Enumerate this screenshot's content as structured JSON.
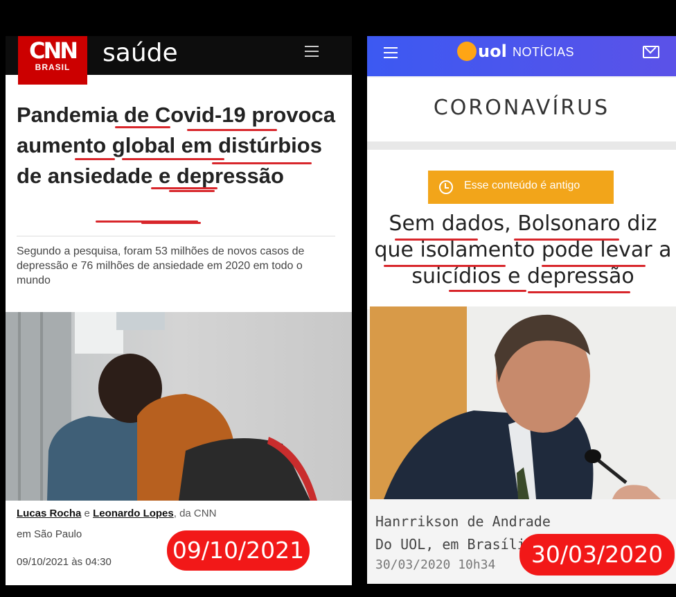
{
  "cnn": {
    "logo_main": "CNN",
    "logo_sub": "BRASIL",
    "section": "saúde",
    "headline": "Pandemia de Covid-19 provoca aumento global em distúrbios de ansiedade e depressão",
    "subhead": "Segundo a pesquisa, foram 53 milhões de novos casos de depressão e 76 milhões de ansiedade em 2020 em todo o mundo",
    "author1": "Lucas Rocha",
    "connector": "e",
    "author2": "Leonardo Lopes",
    "source": ", da CNN",
    "location": "em São Paulo",
    "date": "09/10/2021 às 04:30",
    "badge": "09/10/2021"
  },
  "uol": {
    "logo": "uol",
    "section": "NOTÍCIAS",
    "category": "CORONAVÍRUS",
    "old_notice": "Esse conteúdo é antigo",
    "headline": "Sem dados, Bolsonaro diz que isolamento pode levar a suicídios e depressão",
    "author_name": "Hanrrikson de Andrade",
    "author_org": "Do UOL, em Brasília",
    "date": "30/03/2020  10h34",
    "badge": "30/03/2020"
  },
  "colors": {
    "cnn_red": "#cc0000",
    "uol_blue": "#3c59f2",
    "badge_red": "#f21818",
    "notice_orange": "#f2a51a",
    "underline_red": "#d8262b"
  },
  "icons": [
    "menu-icon",
    "mail-icon",
    "clock-icon"
  ]
}
